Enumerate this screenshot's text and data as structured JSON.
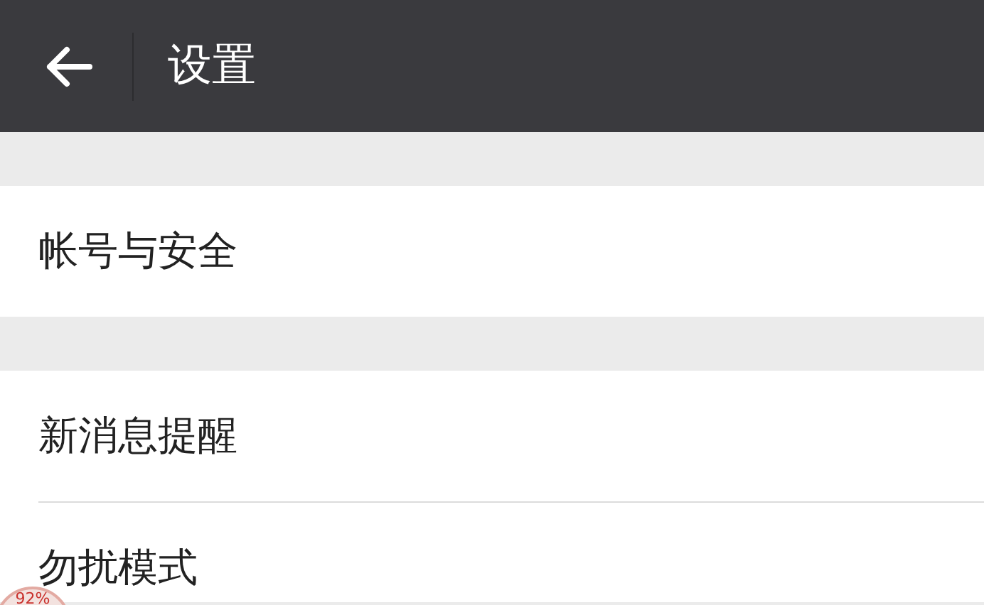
{
  "header": {
    "title": "设置"
  },
  "sections": [
    {
      "items": [
        {
          "label": "帐号与安全"
        }
      ]
    },
    {
      "items": [
        {
          "label": "新消息提醒"
        },
        {
          "label": "勿扰模式"
        }
      ]
    }
  ],
  "floating_ball": {
    "text": "92%"
  }
}
